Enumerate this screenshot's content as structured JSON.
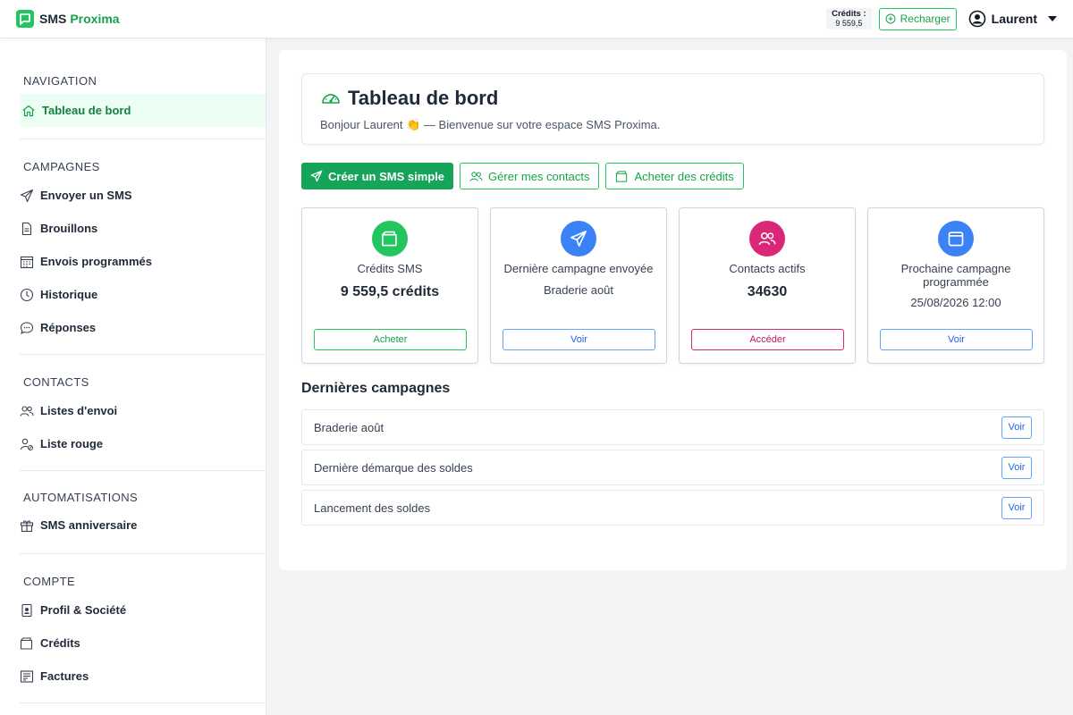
{
  "header": {
    "brand_name": "SMS",
    "brand_accent": "Proxima",
    "credits_label": "Crédits :",
    "credits_value": "9 559,5",
    "recharge_label": "Recharger",
    "user_name": "Laurent"
  },
  "sidebar": {
    "sections": [
      {
        "title": "NAVIGATION",
        "items": [
          {
            "label": "Tableau de bord",
            "icon": "home-icon",
            "active": true
          }
        ]
      },
      {
        "title": "CAMPAGNES",
        "items": [
          {
            "label": "Envoyer un SMS",
            "icon": "send-icon"
          },
          {
            "label": "Brouillons",
            "icon": "document-icon"
          },
          {
            "label": "Envois programmés",
            "icon": "calendar-icon"
          },
          {
            "label": "Historique",
            "icon": "clock-icon"
          },
          {
            "label": "Réponses",
            "icon": "chat-icon"
          }
        ]
      },
      {
        "title": "CONTACTS",
        "items": [
          {
            "label": "Listes d'envoi",
            "icon": "users-icon"
          },
          {
            "label": "Liste rouge",
            "icon": "user-block-icon"
          }
        ]
      },
      {
        "title": "AUTOMATISATIONS",
        "items": [
          {
            "label": "SMS anniversaire",
            "icon": "gift-icon"
          }
        ]
      },
      {
        "title": "COMPTE",
        "items": [
          {
            "label": "Profil & Société",
            "icon": "id-badge-icon"
          },
          {
            "label": "Crédits",
            "icon": "wallet-icon"
          },
          {
            "label": "Factures",
            "icon": "invoice-icon"
          }
        ]
      }
    ]
  },
  "main": {
    "title": "Tableau de bord",
    "subtitle": "Bonjour Laurent 👏 — Bienvenue sur votre espace SMS Proxima.",
    "actions": {
      "create_sms": "Créer un SMS simple",
      "manage_contacts": "Gérer mes contacts",
      "buy_credits": "Acheter des crédits"
    },
    "cards": [
      {
        "title": "Crédits SMS",
        "value": "9 559,5 crédits",
        "button": "Acheter",
        "color": "#22c55e"
      },
      {
        "title": "Dernière campagne envoyée",
        "value": "Braderie août",
        "button": "Voir",
        "color": "#3b82f6"
      },
      {
        "title": "Contacts actifs",
        "value": "34630",
        "button": "Accéder",
        "color": "#db2777"
      },
      {
        "title": "Prochaine campagne programmée",
        "value": "25/08/2026 12:00",
        "button": "Voir",
        "color": "#3b82f6"
      }
    ],
    "recent_title": "Dernières campagnes",
    "recent": [
      {
        "name": "Braderie août",
        "button": "Voir"
      },
      {
        "name": "Dernière démarque des soldes",
        "button": "Voir"
      },
      {
        "name": "Lancement des soldes",
        "button": "Voir"
      }
    ]
  }
}
